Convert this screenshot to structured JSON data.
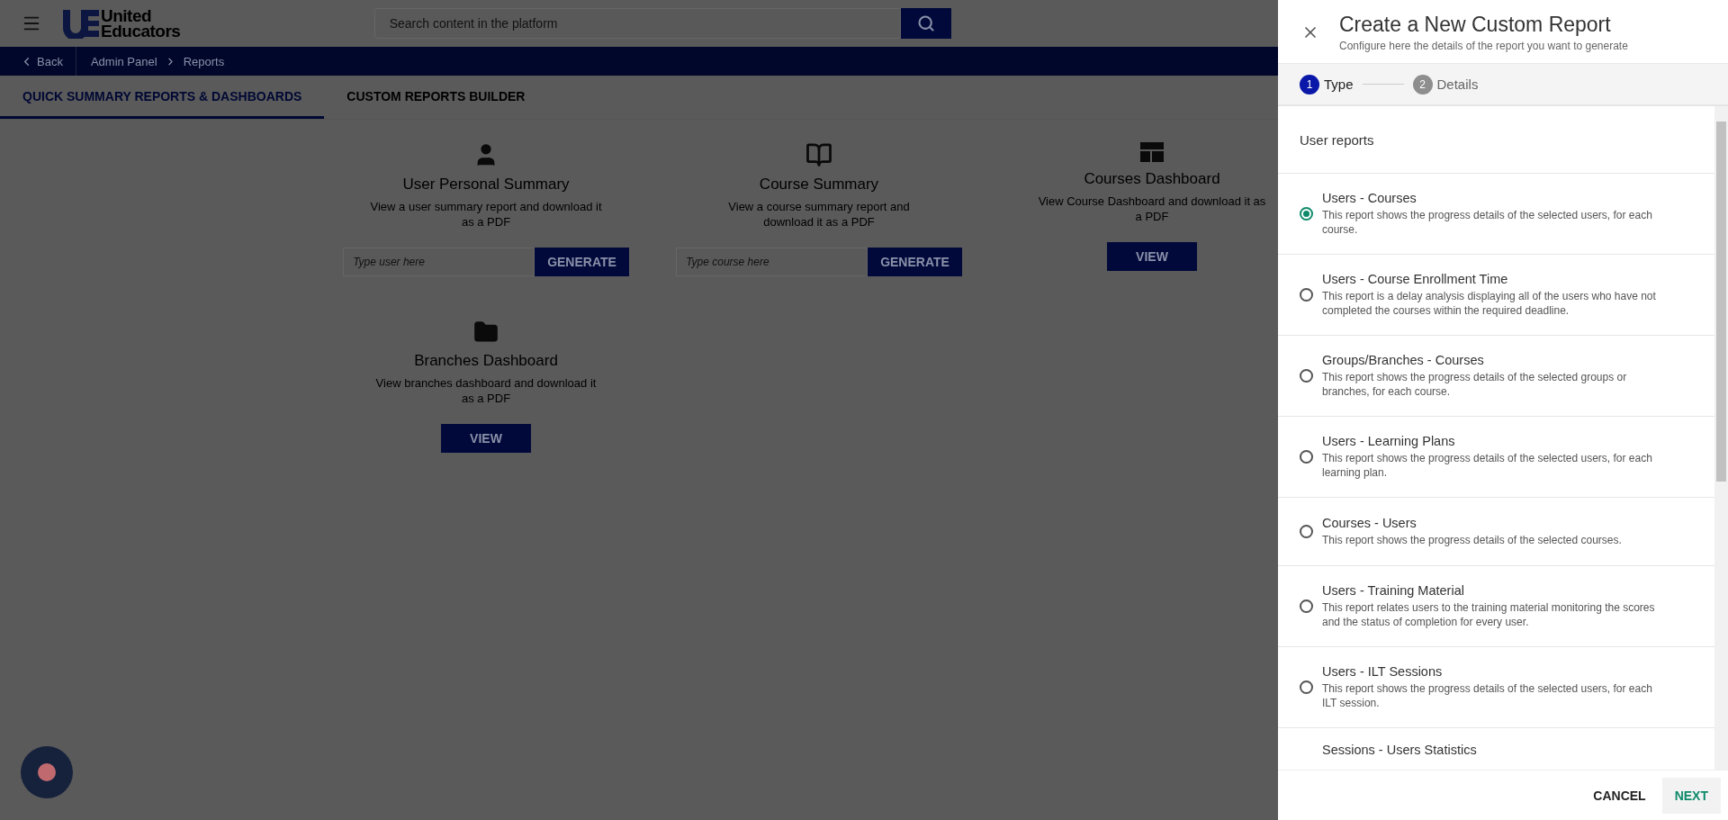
{
  "header": {
    "logo_line1": "United",
    "logo_line2": "Educators",
    "search_placeholder": "Search content in the platform"
  },
  "breadcrumb": {
    "back": "Back",
    "items": [
      "Admin Panel",
      "Reports"
    ]
  },
  "tabs": [
    {
      "label": "QUICK SUMMARY REPORTS & DASHBOARDS",
      "selected": true
    },
    {
      "label": "CUSTOM REPORTS BUILDER",
      "selected": false
    }
  ],
  "cards": [
    {
      "kind": "input",
      "title": "User Personal Summary",
      "description": "View a user summary report and download it as a PDF",
      "placeholder": "Type user here",
      "button": "GENERATE"
    },
    {
      "kind": "input",
      "title": "Course Summary",
      "description": "View a course summary report and download it as a PDF",
      "placeholder": "Type course here",
      "button": "GENERATE"
    },
    {
      "kind": "view",
      "title": "Courses Dashboard",
      "description": "View Course Dashboard and download it as a PDF",
      "button": "VIEW"
    },
    {
      "kind": "view",
      "title": "Branches Dashboard",
      "description": "View branches dashboard and download it as a PDF",
      "button": "VIEW"
    }
  ],
  "drawer": {
    "title": "Create a New Custom Report",
    "subtitle": "Configure here the details of the report you want to generate",
    "steps": [
      {
        "number": "1",
        "label": "Type",
        "selected": true
      },
      {
        "number": "2",
        "label": "Details",
        "selected": false
      }
    ],
    "section_title": "User reports",
    "reports": [
      {
        "title": "Users - Courses",
        "description": "This report shows the progress details of the selected users, for each course.",
        "selected": true
      },
      {
        "title": "Users - Course Enrollment Time",
        "description": "This report is a delay analysis displaying all of the users who have not completed the courses within the required deadline.",
        "selected": false
      },
      {
        "title": "Groups/Branches - Courses",
        "description": "This report shows the progress details of the selected groups or branches, for each course.",
        "selected": false
      },
      {
        "title": "Users - Learning Plans",
        "description": "This report shows the progress details of the selected users, for each learning plan.",
        "selected": false
      },
      {
        "title": "Courses - Users",
        "description": "This report shows the progress details of the selected courses.",
        "selected": false
      },
      {
        "title": "Users - Training Material",
        "description": "This report relates users to the training material monitoring the scores and the status of completion for every user.",
        "selected": false
      },
      {
        "title": "Users - ILT Sessions",
        "description": "This report shows the progress details of the selected users, for each ILT session.",
        "selected": false
      },
      {
        "title": "Sessions - Users Statistics"
      }
    ],
    "cancel": "CANCEL",
    "next": "NEXT"
  }
}
